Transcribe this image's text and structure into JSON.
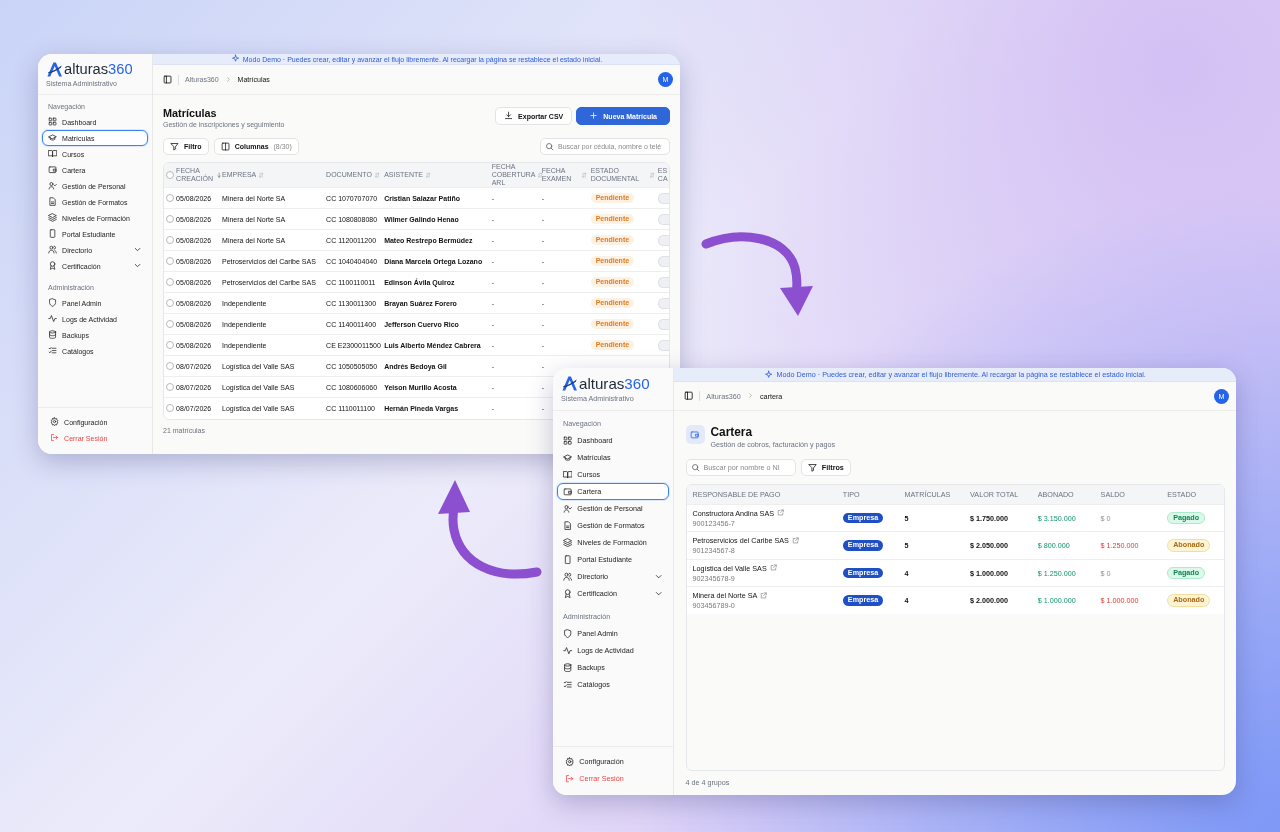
{
  "windows": [
    {
      "kind": "matriculas",
      "banner": "Modo Demo · Puedes crear, editar y avanzar el flujo libremente. Al recargar la página se restablece el estado inicial.",
      "brand": {
        "name": "alturas",
        "accent": "360",
        "subtitle": "Sistema Administrativo"
      },
      "sidebar": {
        "sections": [
          {
            "title": "Navegación",
            "items": [
              {
                "label": "Dashboard",
                "selected": false,
                "expandable": false
              },
              {
                "label": "Matrículas",
                "selected": true,
                "expandable": false
              },
              {
                "label": "Cursos",
                "selected": false,
                "expandable": false
              },
              {
                "label": "Cartera",
                "selected": false,
                "expandable": false
              },
              {
                "label": "Gestión de Personal",
                "selected": false,
                "expandable": false
              },
              {
                "label": "Gestión de Formatos",
                "selected": false,
                "expandable": false
              },
              {
                "label": "Niveles de Formación",
                "selected": false,
                "expandable": false
              },
              {
                "label": "Portal Estudiante",
                "selected": false,
                "expandable": false
              },
              {
                "label": "Directorio",
                "selected": false,
                "expandable": true
              },
              {
                "label": "Certificación",
                "selected": false,
                "expandable": true
              }
            ]
          },
          {
            "title": "Administración",
            "items": [
              {
                "label": "Panel Admin",
                "selected": false,
                "expandable": false
              },
              {
                "label": "Logs de Actividad",
                "selected": false,
                "expandable": false
              },
              {
                "label": "Backups",
                "selected": false,
                "expandable": false
              },
              {
                "label": "Catálogos",
                "selected": false,
                "expandable": false
              }
            ]
          }
        ],
        "footer": [
          {
            "label": "Configuración",
            "kind": "settings"
          },
          {
            "label": "Cerrar Sesión",
            "kind": "logout"
          }
        ]
      },
      "breadcrumb": [
        "Alturas360",
        "Matrículas"
      ],
      "avatar": "M",
      "page": {
        "title": "Matrículas",
        "subtitle": "Gestión de inscripciones y seguimiento",
        "actions": [
          {
            "label": "Exportar CSV",
            "kind": "secondary"
          },
          {
            "label": "Nueva Matrícula",
            "kind": "primary"
          }
        ],
        "filters": [
          {
            "label": "Filtro"
          },
          {
            "label": "Columnas",
            "count": "(8/30)"
          }
        ],
        "search": {
          "placeholder": "Buscar por cédula, nombre o telé"
        },
        "table": {
          "select_all": {
            "checked": false
          },
          "columns": [
            {
              "label": "FECHA CREACIÓN",
              "sorted": true
            },
            {
              "label": "EMPRESA",
              "sorted": false
            },
            {
              "label": "DOCUMENTO",
              "sorted": false
            },
            {
              "label": "ASISTENTE",
              "sorted": false
            },
            {
              "label": "FECHA COBERTURA ARL",
              "sorted": false
            },
            {
              "label": "FECHA EXAMEN",
              "sorted": false
            },
            {
              "label": "ESTADO DOCUMENTAL",
              "sorted": false
            },
            {
              "label": "ES CA"
            }
          ],
          "rows": [
            {
              "checked": false,
              "cells": [
                "05/08/2026",
                "Minera del Norte SA",
                "CC 1070707070",
                "Cristian Salazar Patiño",
                "-",
                "-"
              ],
              "estado": {
                "label": "Pendiente",
                "kind": "pending"
              },
              "column_9_badge": true
            },
            {
              "checked": false,
              "cells": [
                "05/08/2026",
                "Minera del Norte SA",
                "CC 1080808080",
                "Wilmer Galindo Henao",
                "-",
                "-"
              ],
              "estado": {
                "label": "Pendiente",
                "kind": "pending"
              },
              "column_9_badge": true
            },
            {
              "checked": false,
              "cells": [
                "05/08/2026",
                "Minera del Norte SA",
                "CC 1120011200",
                "Mateo Restrepo Bermúdez",
                "-",
                "-"
              ],
              "estado": {
                "label": "Pendiente",
                "kind": "pending"
              },
              "column_9_badge": true
            },
            {
              "checked": false,
              "cells": [
                "05/08/2026",
                "Petroservicios del Caribe SAS",
                "CC 1040404040",
                "Diana Marcela Ortega Lozano",
                "-",
                "-"
              ],
              "estado": {
                "label": "Pendiente",
                "kind": "pending"
              },
              "column_9_badge": true
            },
            {
              "checked": false,
              "cells": [
                "05/08/2026",
                "Petroservicios del Caribe SAS",
                "CC 1100110011",
                "Edinson Ávila Quiroz",
                "-",
                "-"
              ],
              "estado": {
                "label": "Pendiente",
                "kind": "pending"
              },
              "column_9_badge": true
            },
            {
              "checked": false,
              "cells": [
                "05/08/2026",
                "Independiente",
                "CC 1130011300",
                "Brayan Suárez Forero",
                "-",
                "-"
              ],
              "estado": {
                "label": "Pendiente",
                "kind": "pending"
              },
              "column_9_badge": true
            },
            {
              "checked": false,
              "cells": [
                "05/08/2026",
                "Independiente",
                "CC 1140011400",
                "Jefferson Cuervo Rico",
                "-",
                "-"
              ],
              "estado": {
                "label": "Pendiente",
                "kind": "pending"
              },
              "column_9_badge": true
            },
            {
              "checked": false,
              "cells": [
                "05/08/2026",
                "Independiente",
                "CE E2300011500",
                "Luis Alberto Méndez Cabrera",
                "-",
                "-"
              ],
              "estado": {
                "label": "Pendiente",
                "kind": "pending"
              },
              "column_9_badge": true
            },
            {
              "checked": false,
              "cells": [
                "08/07/2026",
                "Logística del Valle SAS",
                "CC 1050505050",
                "Andrés Bedoya Gil",
                "-",
                "-"
              ]
            },
            {
              "checked": false,
              "cells": [
                "08/07/2026",
                "Logística del Valle SAS",
                "CC 1080606060",
                "Yeison Murillo Acosta",
                "-",
                "-"
              ]
            },
            {
              "checked": false,
              "cells": [
                "08/07/2026",
                "Logística del Valle SAS",
                "CC 1110011100",
                "Hernán Pineda Vargas",
                "-",
                "-"
              ]
            }
          ]
        },
        "footer": "21 matrículas"
      }
    },
    {
      "kind": "cartera",
      "banner": "Modo Demo · Puedes crear, editar y avanzar el flujo libremente. Al recargar la página se restablece el estado inicial.",
      "brand": {
        "name": "alturas",
        "accent": "360",
        "subtitle": "Sistema Administrativo"
      },
      "sidebar": {
        "sections": [
          {
            "title": "Navegación",
            "items": [
              {
                "label": "Dashboard",
                "selected": false,
                "expandable": false
              },
              {
                "label": "Matrículas",
                "selected": false,
                "expandable": false
              },
              {
                "label": "Cursos",
                "selected": false,
                "expandable": false
              },
              {
                "label": "Cartera",
                "selected": true,
                "expandable": false
              },
              {
                "label": "Gestión de Personal",
                "selected": false,
                "expandable": false
              },
              {
                "label": "Gestión de Formatos",
                "selected": false,
                "expandable": false
              },
              {
                "label": "Niveles de Formación",
                "selected": false,
                "expandable": false
              },
              {
                "label": "Portal Estudiante",
                "selected": false,
                "expandable": false
              },
              {
                "label": "Directorio",
                "selected": false,
                "expandable": true
              },
              {
                "label": "Certificación",
                "selected": false,
                "expandable": true
              }
            ]
          },
          {
            "title": "Administración",
            "items": [
              {
                "label": "Panel Admin",
                "selected": false,
                "expandable": false
              },
              {
                "label": "Logs de Actividad",
                "selected": false,
                "expandable": false
              },
              {
                "label": "Backups",
                "selected": false,
                "expandable": false
              },
              {
                "label": "Catálogos",
                "selected": false,
                "expandable": false
              }
            ]
          }
        ],
        "footer": [
          {
            "label": "Configuración",
            "kind": "settings"
          },
          {
            "label": "Cerrar Sesión",
            "kind": "logout"
          }
        ]
      },
      "breadcrumb": [
        "Alturas360",
        "cartera"
      ],
      "avatar": "M",
      "page": {
        "title": "Cartera",
        "subtitle": "Gestión de cobros, facturación y pagos",
        "search": {
          "placeholder": "Buscar por nombre o NI"
        },
        "filters": [
          {
            "label": "Filtros"
          }
        ],
        "table": {
          "columns": [
            "RESPONSABLE DE PAGO",
            "TIPO",
            "MATRÍCULAS",
            "VALOR TOTAL",
            "ABONADO",
            "SALDO",
            "ESTADO"
          ],
          "rows": [
            {
              "name": "Constructora Andina SAS",
              "nit": "900123456-7",
              "tipo": "Empresa",
              "matriculas": "5",
              "valor_total": "$ 1.750.000",
              "abonado": "$ 3.150.000",
              "saldo": "$ 0",
              "saldo_due": false,
              "estado": {
                "label": "Pagado",
                "kind": "paid"
              }
            },
            {
              "name": "Petroservicios del Caribe SAS",
              "nit": "901234567-8",
              "tipo": "Empresa",
              "matriculas": "5",
              "valor_total": "$ 2.050.000",
              "abonado": "$ 800.000",
              "saldo": "$ 1.250.000",
              "saldo_due": true,
              "estado": {
                "label": "Abonado",
                "kind": "partial"
              }
            },
            {
              "name": "Logística del Valle SAS",
              "nit": "902345678-9",
              "tipo": "Empresa",
              "matriculas": "4",
              "valor_total": "$ 1.000.000",
              "abonado": "$ 1.250.000",
              "saldo": "$ 0",
              "saldo_due": false,
              "estado": {
                "label": "Pagado",
                "kind": "paid"
              }
            },
            {
              "name": "Minera del Norte SA",
              "nit": "903456789-0",
              "tipo": "Empresa",
              "matriculas": "4",
              "valor_total": "$ 2.000.000",
              "abonado": "$ 1.000.000",
              "saldo": "$ 1.000.000",
              "saldo_due": true,
              "estado": {
                "label": "Abonado",
                "kind": "partial"
              }
            }
          ]
        },
        "footer": "4 de 4 grupos"
      }
    }
  ]
}
